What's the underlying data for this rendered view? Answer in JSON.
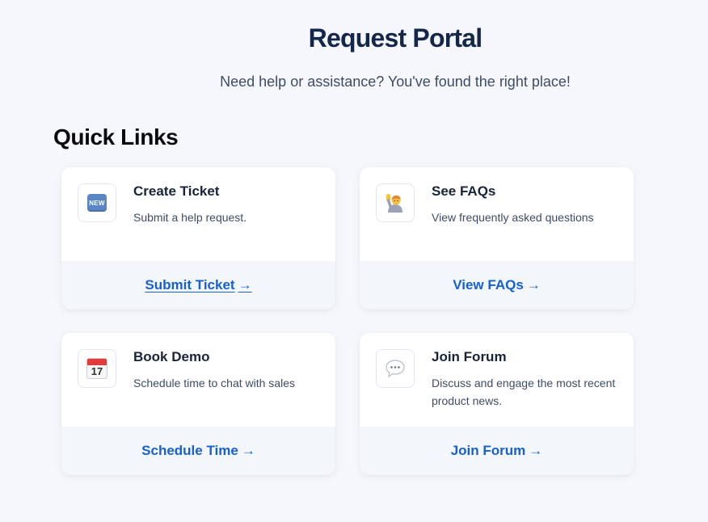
{
  "header": {
    "title": "Request Portal",
    "subtitle": "Need help or assistance? You've found the right place!"
  },
  "section": {
    "title": "Quick Links"
  },
  "cards": [
    {
      "icon": "new-badge-icon",
      "icon_text": "NEW",
      "title": "Create Ticket",
      "description": "Submit a help request.",
      "link": "Submit Ticket",
      "arrow": "→"
    },
    {
      "icon": "person-raising-hand-icon",
      "title": "See FAQs",
      "description": "View frequently asked questions",
      "link": "View FAQs",
      "arrow": "→"
    },
    {
      "icon": "calendar-icon",
      "icon_text": "17",
      "title": "Book Demo",
      "description": "Schedule time to chat with sales",
      "link": "Schedule Time",
      "arrow": "→"
    },
    {
      "icon": "speech-bubble-icon",
      "title": "Join Forum",
      "description": "Discuss and engage the most recent product news.",
      "link": "Join Forum",
      "arrow": "→"
    }
  ],
  "colors": {
    "background": "#f5f7fc",
    "title": "#14264a",
    "link": "#1660d0",
    "card_footer": "#f3f6fb"
  }
}
